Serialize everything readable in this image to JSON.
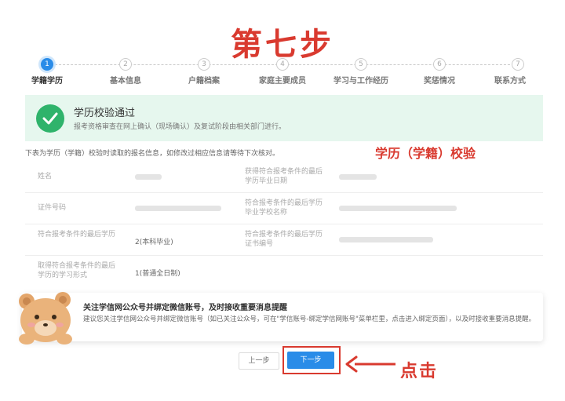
{
  "title_overlay": "第七步",
  "steps": [
    {
      "num": "1",
      "label": "学籍学历",
      "active": true
    },
    {
      "num": "2",
      "label": "基本信息"
    },
    {
      "num": "3",
      "label": "户籍档案"
    },
    {
      "num": "4",
      "label": "家庭主要成员"
    },
    {
      "num": "5",
      "label": "学习与工作经历"
    },
    {
      "num": "6",
      "label": "奖惩情况"
    },
    {
      "num": "7",
      "label": "联系方式"
    }
  ],
  "banner": {
    "title": "学历校验通过",
    "subtitle": "报考资格审查在网上确认（现场确认）及复试阶段由相关部门进行。"
  },
  "note": "下表为学历（学籍）校验时读取的报名信息，如修改过相应信息请等待下次核对。",
  "annotation_right": "学历（学籍）校验",
  "table": {
    "rows": [
      {
        "label1": "姓名",
        "label2": "获得符合报考条件的最后学历毕业日期"
      },
      {
        "label1": "证件号码",
        "label2": "符合报考条件的最后学历毕业学校名称"
      },
      {
        "label1": "符合报考条件的最后学历",
        "value1": "2(本科毕业)",
        "label2": "符合报考条件的最后学历证书编号"
      },
      {
        "label1": "取得符合报考条件的最后学历的学习形式",
        "value1": "1(普通全日制)"
      }
    ]
  },
  "popup": {
    "title": "关注学信网公众号并绑定微信账号，及时接收重要消息提醒",
    "text": "建议您关注学信网公众号并绑定微信账号（如已关注公众号，可在\"学信账号-绑定学信网账号\"菜单栏里，点击进入绑定页面），以及时接收重要消息提醒。"
  },
  "buttons": {
    "prev": "上一步",
    "next": "下一步"
  },
  "annotation_click": "点击",
  "colors": {
    "accent": "#2a8ce8",
    "annotation": "#d93a2f",
    "success": "#2fb36b",
    "banner_bg": "#e6f7ee"
  }
}
